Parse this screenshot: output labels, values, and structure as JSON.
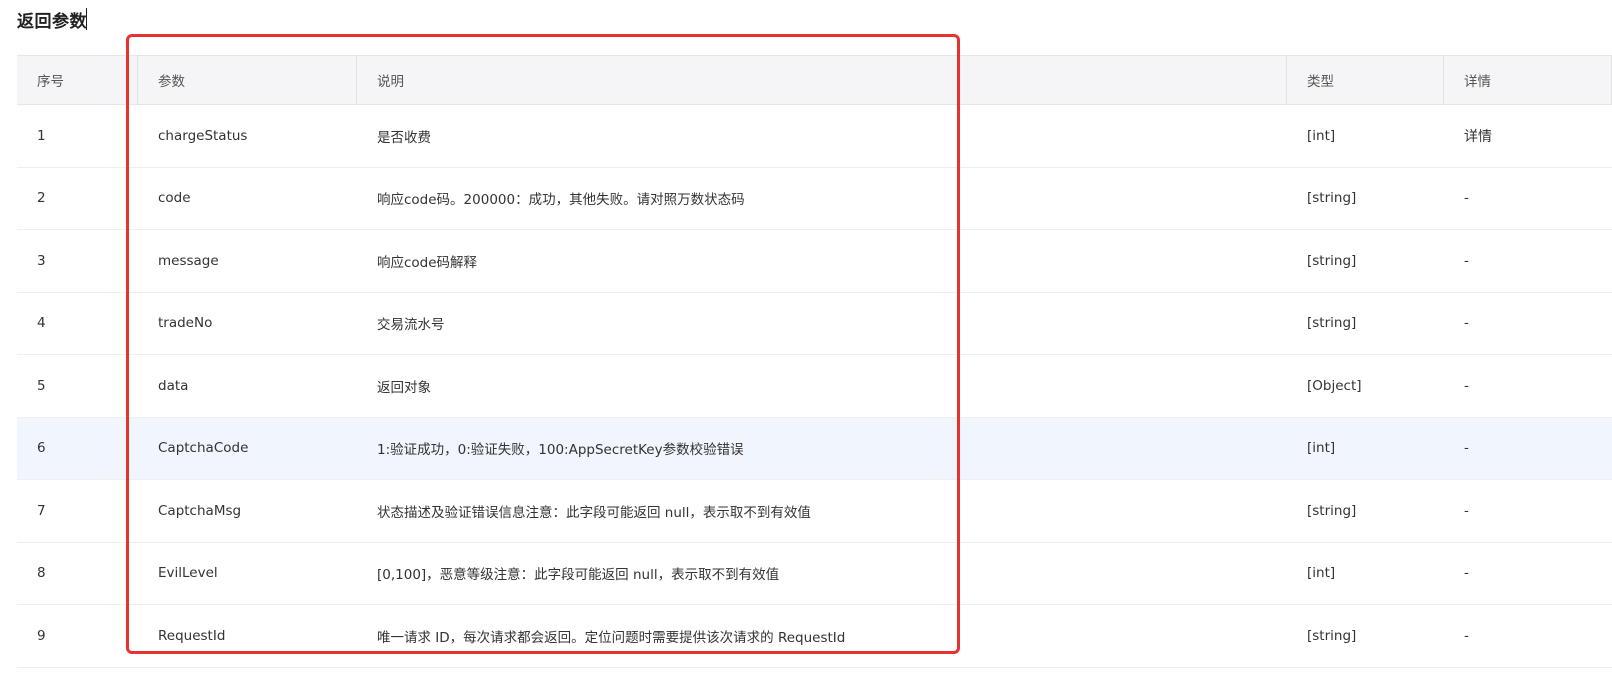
{
  "section": {
    "title": "返回参数"
  },
  "table": {
    "headers": {
      "index": "序号",
      "param": "参数",
      "desc": "说明",
      "type": "类型",
      "detail": "详情"
    },
    "rows": [
      {
        "index": "1",
        "param": "chargeStatus",
        "desc": "是否收费",
        "type": "[int]",
        "detail": "详情"
      },
      {
        "index": "2",
        "param": "code",
        "desc": "响应code码。200000：成功，其他失败。请对照万数状态码",
        "type": "[string]",
        "detail": "-"
      },
      {
        "index": "3",
        "param": "message",
        "desc": "响应code码解释",
        "type": "[string]",
        "detail": "-"
      },
      {
        "index": "4",
        "param": "tradeNo",
        "desc": "交易流水号",
        "type": "[string]",
        "detail": "-"
      },
      {
        "index": "5",
        "param": "data",
        "desc": "返回对象",
        "type": "[Object]",
        "detail": "-"
      },
      {
        "index": "6",
        "param": "CaptchaCode",
        "desc": "1:验证成功，0:验证失败，100:AppSecretKey参数校验错误",
        "type": "[int]",
        "detail": "-"
      },
      {
        "index": "7",
        "param": "CaptchaMsg",
        "desc": "状态描述及验证错误信息注意：此字段可能返回 null，表示取不到有效值",
        "type": "[string]",
        "detail": "-"
      },
      {
        "index": "8",
        "param": "EvilLevel",
        "desc": "[0,100]，恶意等级注意：此字段可能返回 null，表示取不到有效值",
        "type": "[int]",
        "detail": "-"
      },
      {
        "index": "9",
        "param": "RequestId",
        "desc": "唯一请求 ID，每次请求都会返回。定位问题时需要提供该次请求的 RequestId",
        "type": "[string]",
        "detail": "-"
      }
    ]
  },
  "colors": {
    "highlight_row": "#f1f5fd",
    "annotation_box": "#e5332f",
    "header_bg": "#f5f5f7"
  }
}
